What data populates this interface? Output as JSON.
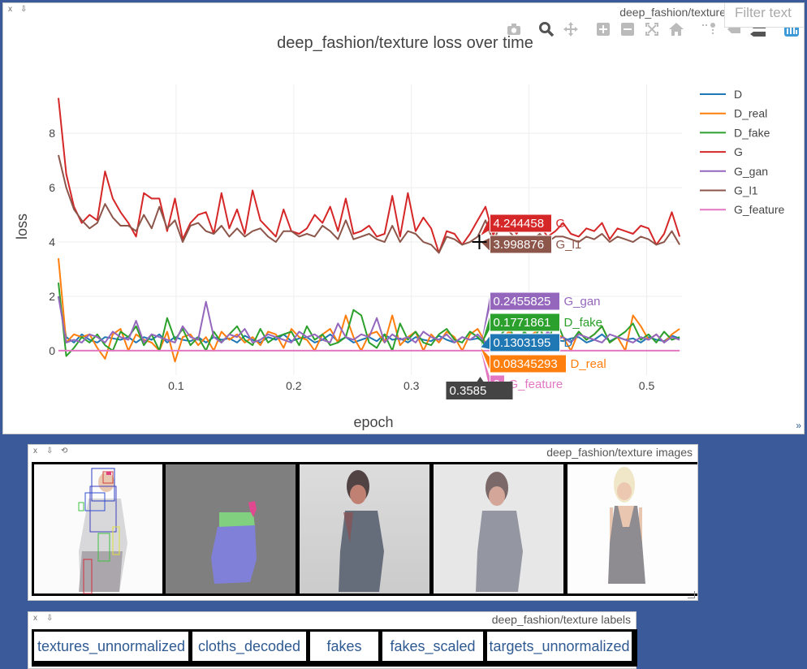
{
  "plot_pane": {
    "close_label": "x",
    "download_label": "⇩",
    "window_title": "deep_fashion/texture",
    "filter_placeholder": "Filter text",
    "corner_label": "»"
  },
  "modebar_icons": [
    "camera-icon",
    "zoom-icon",
    "pan-icon",
    "zoom-in-icon",
    "zoom-out-icon",
    "autoscale-icon",
    "home-icon",
    "spike-lines-icon",
    "hover-closest-icon",
    "hover-compare-icon",
    "plotly-logo-icon"
  ],
  "chart_data": {
    "type": "line",
    "title": "deep_fashion/texture loss over time",
    "xlabel": "epoch",
    "ylabel": "loss",
    "xlim": [
      0,
      0.53
    ],
    "ylim": [
      -0.9,
      9.8
    ],
    "x_ticks": [
      0.1,
      0.2,
      0.3,
      0.4,
      0.5
    ],
    "x_tick_labels": [
      "0.1",
      "0.2",
      "0.3",
      "",
      "0.5"
    ],
    "y_ticks": [
      0,
      2,
      4,
      6,
      8
    ],
    "y_tick_labels": [
      "0",
      "2",
      "4",
      "6",
      "8"
    ],
    "grid": true,
    "legend_position": "right",
    "x": [
      0.0,
      0.0066,
      0.0132,
      0.0198,
      0.0264,
      0.033,
      0.0396,
      0.0462,
      0.0528,
      0.0594,
      0.066,
      0.0726,
      0.0792,
      0.0858,
      0.0924,
      0.099,
      0.1056,
      0.1122,
      0.1188,
      0.1254,
      0.132,
      0.1386,
      0.1452,
      0.1518,
      0.1584,
      0.165,
      0.1716,
      0.1782,
      0.1848,
      0.1914,
      0.198,
      0.2046,
      0.2112,
      0.2178,
      0.2244,
      0.231,
      0.2376,
      0.2442,
      0.2508,
      0.2574,
      0.264,
      0.2706,
      0.2772,
      0.2838,
      0.2904,
      0.297,
      0.3036,
      0.3102,
      0.3168,
      0.3234,
      0.33,
      0.3366,
      0.3432,
      0.3498,
      0.3564,
      0.363,
      0.3696,
      0.3762,
      0.3828,
      0.3894,
      0.396,
      0.4026,
      0.4092,
      0.4158,
      0.4224,
      0.429,
      0.4356,
      0.4422,
      0.4488,
      0.4554,
      0.462,
      0.4686,
      0.4752,
      0.4818,
      0.4884,
      0.495,
      0.5016,
      0.5082,
      0.5148,
      0.5214,
      0.528
    ],
    "series": [
      {
        "name": "D",
        "color": "#1f77b4",
        "values": [
          2.0,
          0.5,
          0.3,
          0.6,
          0.4,
          0.3,
          0.5,
          0.45,
          0.4,
          0.5,
          0.3,
          0.5,
          0.4,
          0.6,
          0.3,
          0.5,
          0.4,
          0.35,
          0.5,
          0.3,
          0.5,
          0.4,
          0.45,
          0.3,
          0.55,
          0.4,
          0.3,
          0.5,
          0.4,
          0.6,
          0.35,
          0.45,
          0.5,
          0.3,
          0.4,
          0.6,
          0.35,
          0.5,
          0.3,
          0.4,
          0.5,
          0.35,
          0.6,
          0.4,
          0.45,
          0.3,
          0.5,
          0.4,
          0.35,
          0.55,
          0.4,
          0.3,
          0.5,
          0.4,
          0.45,
          0.3,
          0.13,
          0.4,
          0.5,
          0.35,
          0.45,
          0.6,
          0.3,
          0.5,
          0.4,
          0.35,
          0.45,
          0.5,
          0.3,
          0.4,
          0.6,
          0.35,
          0.5,
          0.4,
          0.45,
          0.3,
          0.5,
          0.4,
          0.35,
          0.55,
          0.45
        ]
      },
      {
        "name": "D_real",
        "color": "#ff7f0e",
        "values": [
          3.4,
          0.3,
          0.6,
          0.5,
          0.6,
          0.1,
          -0.3,
          0.6,
          0.8,
          0.0,
          0.6,
          0.4,
          0.3,
          0.0,
          0.7,
          -0.4,
          0.5,
          0.6,
          0.2,
          0.5,
          0.0,
          0.7,
          0.4,
          0.6,
          0.3,
          0.5,
          0.2,
          0.7,
          0.6,
          0.1,
          0.8,
          0.5,
          0.4,
          0.0,
          0.6,
          0.8,
          0.3,
          1.3,
          0.5,
          0.0,
          0.6,
          0.7,
          0.3,
          1.3,
          0.2,
          0.5,
          0.7,
          0.0,
          0.6,
          0.3,
          0.7,
          0.5,
          0.0,
          0.6,
          0.8,
          0.3,
          0.08,
          0.4,
          0.7,
          0.5,
          0.0,
          0.6,
          0.8,
          0.3,
          0.6,
          0.5,
          0.0,
          0.7,
          0.4,
          0.6,
          0.9,
          0.3,
          0.5,
          0.0,
          1.3,
          0.9,
          0.4,
          0.6,
          0.3,
          0.6,
          0.8
        ]
      },
      {
        "name": "D_fake",
        "color": "#2ca02c",
        "values": [
          2.5,
          -0.2,
          0.1,
          0.5,
          0.3,
          0.6,
          0.2,
          0.0,
          0.7,
          0.5,
          0.9,
          0.2,
          0.6,
          0.0,
          1.2,
          0.4,
          0.8,
          0.2,
          0.5,
          0.0,
          0.7,
          0.3,
          0.6,
          0.9,
          0.4,
          0.2,
          0.8,
          0.3,
          0.5,
          0.6,
          0.7,
          0.2,
          0.9,
          0.4,
          0.6,
          0.2,
          0.3,
          0.5,
          1.5,
          1.3,
          0.3,
          0.1,
          0.6,
          0.0,
          1.0,
          0.4,
          0.7,
          0.3,
          0.2,
          0.6,
          0.8,
          0.4,
          0.3,
          0.7,
          0.5,
          0.2,
          0.18,
          0.6,
          0.9,
          0.3,
          0.7,
          0.4,
          0.8,
          0.2,
          1.2,
          0.5,
          0.3,
          0.7,
          0.4,
          0.6,
          0.9,
          0.3,
          0.5,
          0.7,
          1.0,
          0.4,
          0.6,
          0.3,
          0.7,
          0.4,
          0.5
        ]
      },
      {
        "name": "G",
        "color": "#d62728",
        "values": [
          9.3,
          6.5,
          5.3,
          4.7,
          5.0,
          4.8,
          6.6,
          5.6,
          5.1,
          4.7,
          4.2,
          5.8,
          5.6,
          5.6,
          4.4,
          5.6,
          4.1,
          4.7,
          5.0,
          5.1,
          4.3,
          5.8,
          4.5,
          5.2,
          4.3,
          5.9,
          4.8,
          4.5,
          4.2,
          5.2,
          4.4,
          4.3,
          4.5,
          5.0,
          4.7,
          5.3,
          4.4,
          5.6,
          4.3,
          4.4,
          4.6,
          4.2,
          4.3,
          5.7,
          4.2,
          5.8,
          4.4,
          4.9,
          4.5,
          3.6,
          4.4,
          4.3,
          3.9,
          4.3,
          4.8,
          5.3,
          4.24,
          5.0,
          4.7,
          4.3,
          4.8,
          4.4,
          4.6,
          4.2,
          4.4,
          4.7,
          4.3,
          4.2,
          4.5,
          4.4,
          4.7,
          4.1,
          4.5,
          4.4,
          4.3,
          4.6,
          4.5,
          3.9,
          4.3,
          5.1,
          4.2
        ]
      },
      {
        "name": "G_gan",
        "color": "#9467bd",
        "values": [
          2.0,
          0.3,
          0.4,
          0.3,
          0.6,
          0.5,
          0.3,
          0.7,
          0.5,
          0.4,
          1.1,
          0.3,
          0.6,
          0.5,
          0.4,
          0.3,
          0.9,
          0.5,
          0.4,
          1.8,
          0.5,
          0.3,
          0.6,
          0.5,
          0.8,
          0.3,
          0.4,
          0.6,
          0.5,
          0.4,
          0.3,
          0.7,
          0.5,
          0.6,
          0.4,
          0.3,
          1.0,
          0.5,
          0.4,
          0.6,
          0.5,
          1.2,
          0.3,
          0.6,
          0.4,
          0.5,
          0.3,
          0.7,
          0.5,
          0.4,
          0.6,
          0.3,
          0.5,
          0.4,
          0.6,
          0.3,
          0.25,
          0.5,
          0.3,
          0.6,
          0.4,
          0.5,
          0.3,
          0.7,
          0.4,
          0.5,
          0.3,
          0.6,
          0.5,
          0.4,
          0.3,
          0.6,
          0.5,
          0.4,
          0.3,
          0.5,
          0.4,
          0.6,
          0.3,
          0.5,
          0.4
        ]
      },
      {
        "name": "G_l1",
        "color": "#8c564b",
        "values": [
          7.2,
          6.0,
          5.2,
          4.8,
          4.5,
          4.7,
          5.4,
          4.9,
          4.6,
          4.6,
          4.4,
          5.0,
          4.5,
          5.3,
          4.5,
          4.8,
          4.0,
          4.6,
          4.7,
          4.4,
          4.3,
          4.6,
          4.2,
          4.5,
          4.2,
          4.4,
          4.5,
          4.2,
          4.0,
          4.4,
          4.4,
          4.2,
          4.3,
          4.2,
          4.6,
          4.4,
          4.1,
          4.8,
          4.1,
          4.2,
          4.3,
          4.1,
          4.0,
          4.6,
          4.0,
          4.4,
          4.3,
          4.0,
          3.9,
          3.6,
          4.2,
          4.1,
          3.9,
          4.0,
          4.2,
          4.8,
          4.0,
          4.7,
          4.4,
          4.1,
          4.2,
          4.1,
          4.3,
          4.0,
          4.2,
          4.2,
          4.1,
          4.0,
          4.2,
          4.1,
          4.3,
          4.0,
          4.2,
          4.1,
          4.0,
          4.2,
          4.1,
          3.9,
          4.0,
          4.4,
          3.9
        ]
      },
      {
        "name": "G_feature",
        "color": "#e377c2",
        "values": [
          0.0,
          0.0,
          0.0,
          0.0,
          0.0,
          0.0,
          0.0,
          0.0,
          0.0,
          0.0,
          0.0,
          0.0,
          0.0,
          0.0,
          0.0,
          0.0,
          0.0,
          0.0,
          0.0,
          0.0,
          0.0,
          0.0,
          0.0,
          0.0,
          0.0,
          0.0,
          0.0,
          0.0,
          0.0,
          0.0,
          0.0,
          0.0,
          0.0,
          0.0,
          0.0,
          0.0,
          0.0,
          0.0,
          0.0,
          0.0,
          0.0,
          0.0,
          0.0,
          0.0,
          0.0,
          0.0,
          0.0,
          0.0,
          0.0,
          0.0,
          0.0,
          0.0,
          0.0,
          0.0,
          0.0,
          0.0,
          0.0,
          0.0,
          0.0,
          0.0,
          0.0,
          0.0,
          0.0,
          0.0,
          0.0,
          0.0,
          0.0,
          0.0,
          0.0,
          0.0,
          0.0,
          0.0,
          0.0,
          0.0,
          0.0,
          0.0,
          0.0,
          0.0,
          0.0,
          0.0,
          0.0
        ]
      }
    ],
    "hover": {
      "x_label": "0.3585",
      "x_value": 0.3585,
      "items": [
        {
          "series": "G",
          "value_label": "4.244458",
          "y": 4.244458,
          "color": "#d62728"
        },
        {
          "series": "G_l1",
          "value_label": "3.998876",
          "y": 3.998876,
          "color": "#8c564b"
        },
        {
          "series": "G_gan",
          "value_label": "0.2455825",
          "y": 0.2455825,
          "color": "#9467bd"
        },
        {
          "series": "D_fake",
          "value_label": "0.1771861",
          "y": 0.1771861,
          "color": "#2ca02c"
        },
        {
          "series": "D",
          "value_label": "0.1303195",
          "y": 0.1303195,
          "color": "#1f77b4"
        },
        {
          "series": "D_real",
          "value_label": "0.08345293",
          "y": 0.08345293,
          "color": "#ff7f0e"
        },
        {
          "series": "G_feature",
          "value_label": "0",
          "y": 0,
          "color": "#e377c2"
        }
      ]
    }
  },
  "images_pane": {
    "close_label": "x",
    "download_label": "⇩",
    "reset_label": "⟲",
    "title": "deep_fashion/texture images",
    "tiles": [
      "textures-unnormalized-image",
      "cloths-decoded-image",
      "fakes-image",
      "fakes-scaled-image",
      "targets-unnormalized-image"
    ]
  },
  "labels_pane": {
    "close_label": "x",
    "download_label": "⇩",
    "title": "deep_fashion/texture labels",
    "labels": [
      "textures_unnormalized",
      "cloths_decoded",
      "fakes",
      "fakes_scaled",
      "targets_unnormalized"
    ]
  }
}
